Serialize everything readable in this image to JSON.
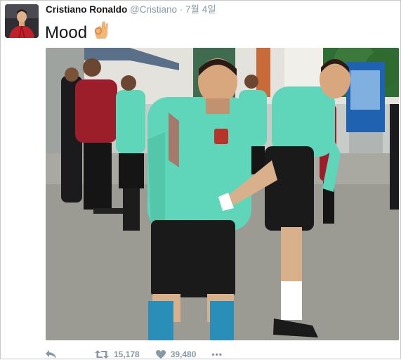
{
  "tweet": {
    "author_name": "Cristiano Ronaldo",
    "handle": "@Cristiano",
    "separator": "·",
    "timestamp": "7월 4일",
    "text": "Mood"
  },
  "icons": {
    "reply": "reply-icon",
    "retweet": "retweet-icon",
    "like": "heart-icon",
    "more": "more-icon",
    "emoji": "ok-hand-emoji"
  },
  "actions": {
    "retweet_count": "15,178",
    "like_count": "39,480",
    "more_label": "•••"
  },
  "colors": {
    "name": "#14171a",
    "meta": "#8899a6",
    "border": "#c9c9c9",
    "jersey_mint": "#5fd6b9",
    "shorts": "#1a1a1a",
    "skin": "#e5b98f"
  }
}
